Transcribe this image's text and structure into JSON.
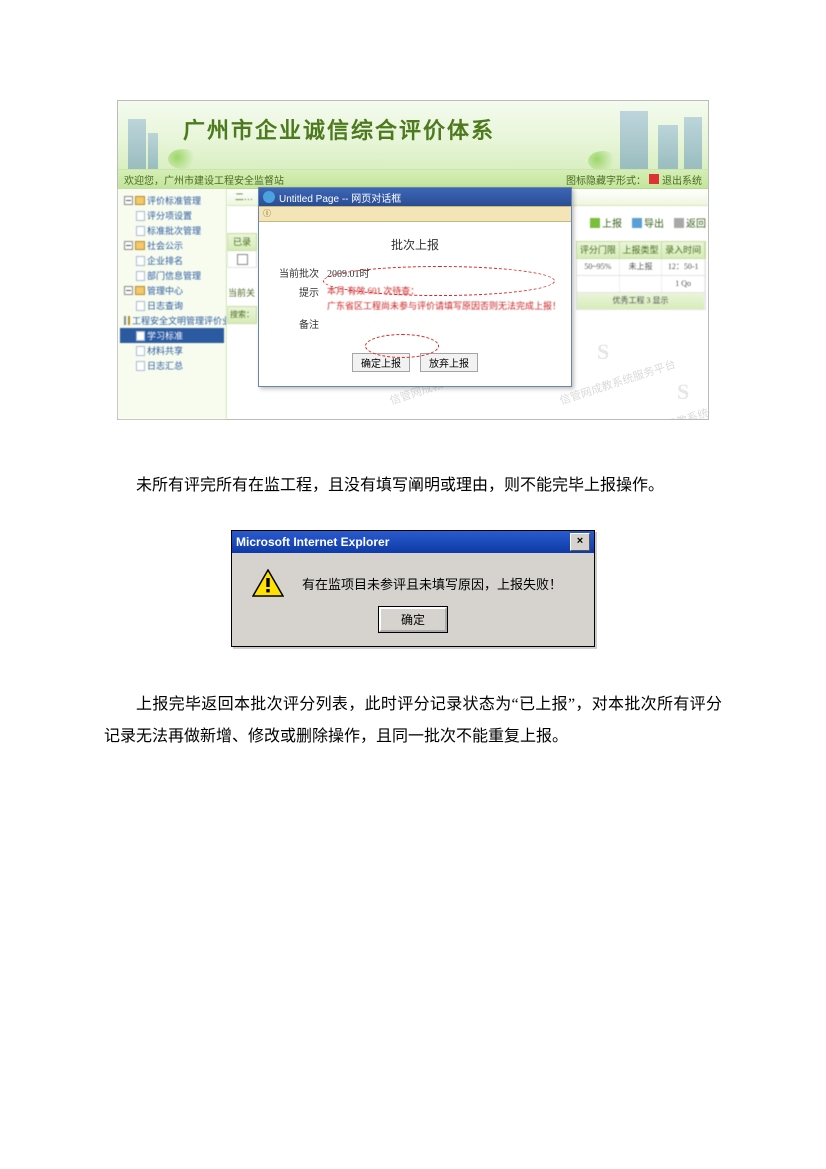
{
  "figure1": {
    "banner_title": "广州市企业诚信综合评价体系",
    "welcome_left": "欢迎您，广州市建设工程安全监督站",
    "welcome_right": "图标隐藏字形式：",
    "exit_label": "退出系统",
    "crumb": "二…",
    "sidebar": {
      "n0": "评价标准管理",
      "n1": "评分项设置",
      "n2": "标准批次管理",
      "n3": "社会公示",
      "n4": "企业排名",
      "n5": "部门信息管理",
      "n6": "管理中心",
      "n7": "日志查询",
      "n8": "工程安全文明管理评价业务",
      "n9": "学习标准",
      "n10": "材料共享",
      "n11": "日志汇总"
    },
    "toolbar": {
      "t1": "上报",
      "t2": "导出",
      "t3": "返回"
    },
    "table": {
      "h1": "评分门限",
      "h2": "上报类型",
      "h3": "录入时间",
      "r1": "50~95%",
      "r2": "未上报",
      "r3": "12：50-1",
      "r4": "1 Qo",
      "foot": "优秀工程  3  显示"
    },
    "leftstrip": {
      "h": "已录",
      "lb": "当前关",
      "pg": "搜索："
    },
    "watermark": "信管网成教系统服务平台",
    "dialog": {
      "title": "Untitled Page -- 网页对话框",
      "url": "Ⓘ",
      "heading": "批次上报",
      "row1_label": "当前批次",
      "row1_value": "2009.01时",
      "row2_label": "提示",
      "row2_line1": "本月 有效 601 次待查：",
      "row2_line2": "广东省区工程尚未参与评价请填写原因否则无法完成上报！",
      "row3_label": "备注",
      "btn_confirm": "确定上报",
      "btn_cancel": "放弃上报"
    }
  },
  "paragraph1": "未所有评完所有在监工程，且没有填写阐明或理由，则不能完毕上报操作。",
  "figure2": {
    "title": "Microsoft Internet Explorer",
    "message": "有在监项目未参评且未填写原因，上报失败！",
    "ok": "确定"
  },
  "paragraph2": "上报完毕返回本批次评分列表，此时评分记录状态为“已上报”，对本批次所有评分记录无法再做新增、修改或删除操作，且同一批次不能重复上报。"
}
